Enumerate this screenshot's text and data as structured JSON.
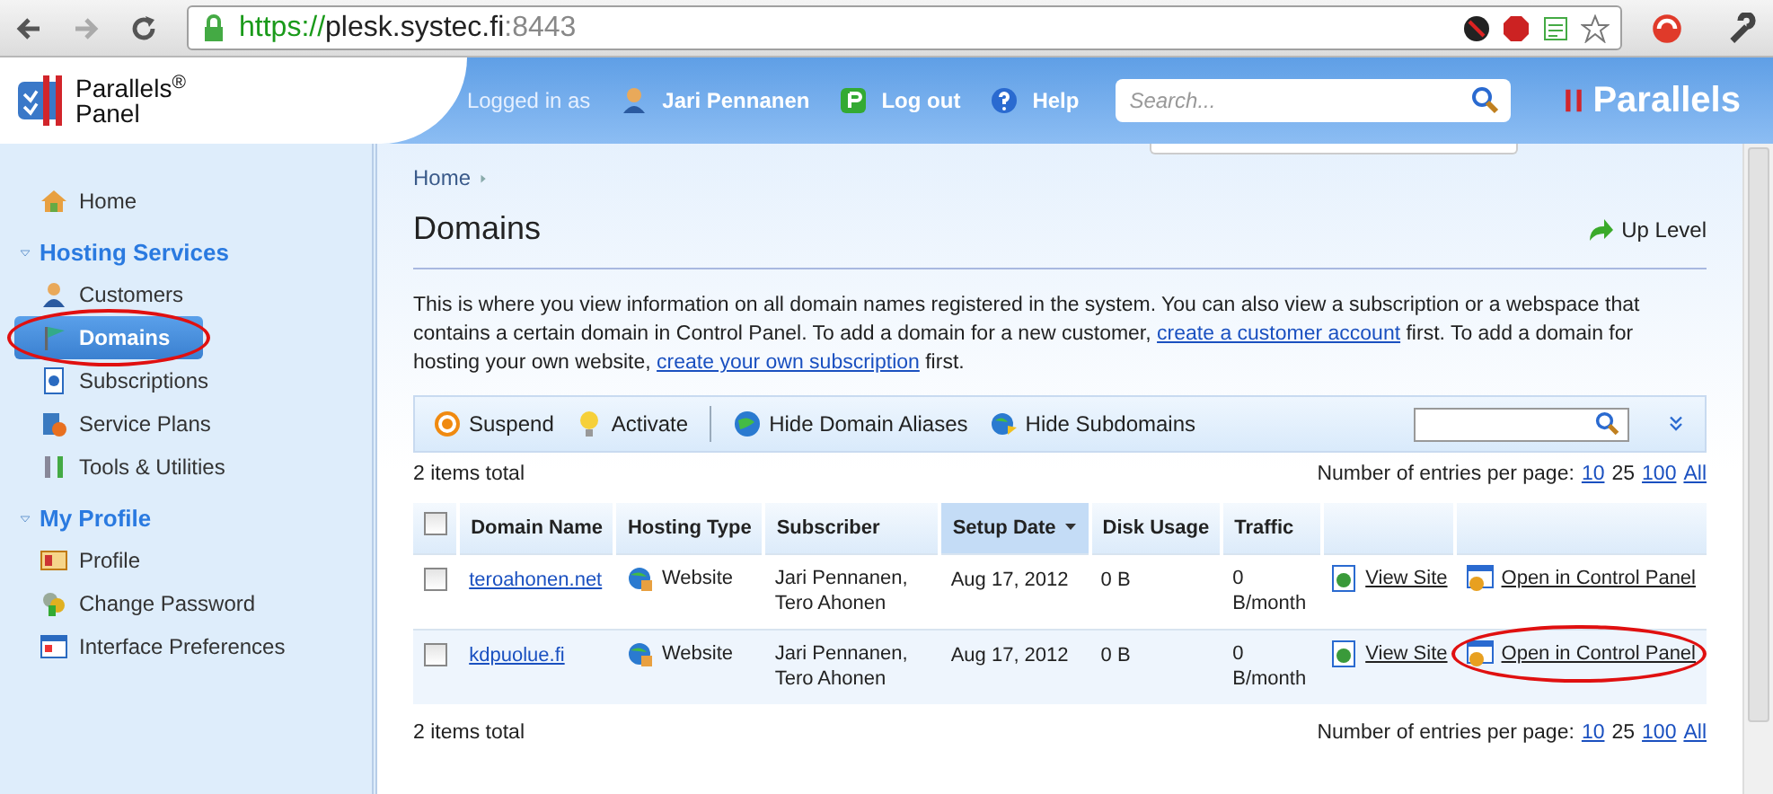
{
  "browser": {
    "url_scheme": "https://",
    "url_host": "plesk.systec.fi",
    "url_port": ":8443"
  },
  "header": {
    "logo_line1": "Parallels$^{®}$",
    "logo_line2": "Panel",
    "logged_in_label": "Logged in as",
    "user_name": "Jari Pennanen",
    "log_out": "Log out",
    "help": "Help",
    "search_placeholder": "Search...",
    "brand": "Parallels"
  },
  "sidebar": {
    "top": [
      {
        "label": "Home",
        "selected": false
      }
    ],
    "groups": [
      {
        "title": "Hosting Services",
        "items": [
          {
            "label": "Customers",
            "selected": false
          },
          {
            "label": "Domains",
            "selected": true
          },
          {
            "label": "Subscriptions",
            "selected": false
          },
          {
            "label": "Service Plans",
            "selected": false
          },
          {
            "label": "Tools & Utilities",
            "selected": false
          }
        ]
      },
      {
        "title": "My Profile",
        "items": [
          {
            "label": "Profile",
            "selected": false
          },
          {
            "label": "Change Password",
            "selected": false
          },
          {
            "label": "Interface Preferences",
            "selected": false
          }
        ]
      }
    ]
  },
  "content": {
    "breadcrumb": "Home",
    "title": "Domains",
    "up_level": "Up Level",
    "description": {
      "text_1": "This is where you view information on all domain names registered in the system. You can also view a subscription or a webspace that contains a certain domain in Control Panel. To add a domain for a new customer, ",
      "link_1": "create a customer account",
      "text_2": " first. To add a domain for hosting your own website, ",
      "link_2": "create your own subscription",
      "text_3": " first."
    },
    "toolbar": [
      "Suspend",
      "Activate",
      "Hide Domain Aliases",
      "Hide Subdomains"
    ],
    "items_total_top": "2 items total",
    "per_page_label_top": "Number of entries per page:",
    "per_page_top": [
      {
        "label": "10",
        "selected": false
      },
      {
        "label": "25",
        "selected": true
      },
      {
        "label": "100",
        "selected": false
      },
      {
        "label": "All",
        "selected": false
      }
    ],
    "table": {
      "select_all_checked": false,
      "columns": [
        {
          "label": "Domain Name",
          "sorted": false
        },
        {
          "label": "Hosting Type",
          "sorted": false
        },
        {
          "label": "Subscriber",
          "sorted": false
        },
        {
          "label": "Setup Date",
          "sorted": true
        },
        {
          "label": "Disk Usage",
          "sorted": false
        },
        {
          "label": "Traffic",
          "sorted": false
        }
      ],
      "rows": [
        {
          "checked": false,
          "domain": "teroahonen.net",
          "hosting_type": "Website",
          "subscriber": "Jari Pennanen, Tero Ahonen",
          "setup_date": "Aug 17, 2012",
          "disk_usage": "0 B",
          "traffic": "0 B/month",
          "view_site": "View Site",
          "open_panel": "Open in Control Panel",
          "circled": false
        },
        {
          "checked": false,
          "domain": "kdpuolue.fi",
          "hosting_type": "Website",
          "subscriber": "Jari Pennanen, Tero Ahonen",
          "setup_date": "Aug 17, 2012",
          "disk_usage": "0 B",
          "traffic": "0 B/month",
          "view_site": "View Site",
          "open_panel": "Open in Control Panel",
          "circled": true
        }
      ]
    },
    "items_total_bottom": "2 items total",
    "per_page_label_bottom": "Number of entries per page:",
    "per_page_bottom": [
      {
        "label": "10",
        "selected": false
      },
      {
        "label": "25",
        "selected": true
      },
      {
        "label": "100",
        "selected": false
      },
      {
        "label": "All",
        "selected": false
      }
    ]
  }
}
